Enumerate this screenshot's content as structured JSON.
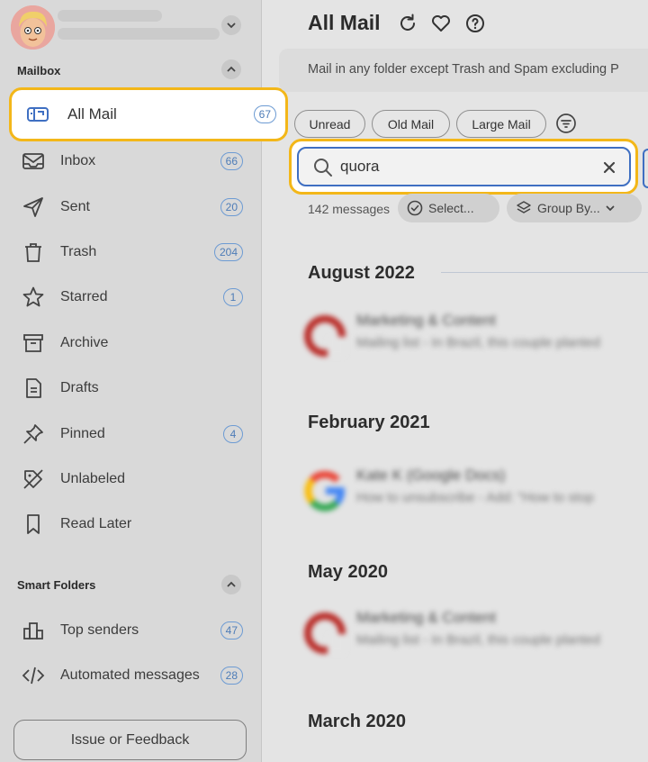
{
  "sidebar": {
    "mailbox_title": "Mailbox",
    "items": [
      {
        "label": "All Mail",
        "count": "67",
        "icon": "mailbox-icon",
        "active": true
      },
      {
        "label": "Inbox",
        "count": "66",
        "icon": "inbox-icon"
      },
      {
        "label": "Sent",
        "count": "20",
        "icon": "paper-plane-icon"
      },
      {
        "label": "Trash",
        "count": "204",
        "icon": "trash-icon"
      },
      {
        "label": "Starred",
        "count": "1",
        "icon": "star-icon"
      },
      {
        "label": "Archive",
        "count": "",
        "icon": "archive-box-icon"
      },
      {
        "label": "Drafts",
        "count": "",
        "icon": "document-icon"
      },
      {
        "label": "Pinned",
        "count": "4",
        "icon": "pin-icon"
      },
      {
        "label": "Unlabeled",
        "count": "",
        "icon": "label-off-icon"
      },
      {
        "label": "Read Later",
        "count": "",
        "icon": "bookmark-icon"
      }
    ],
    "smart_title": "Smart Folders",
    "smart_items": [
      {
        "label": "Top senders",
        "count": "47",
        "icon": "bar-chart-icon"
      },
      {
        "label": "Automated messages",
        "count": "28",
        "icon": "code-icon"
      }
    ],
    "feedback_label": "Issue or Feedback"
  },
  "main": {
    "title": "All Mail",
    "description": "Mail in any folder except Trash and Spam excluding P",
    "chips": [
      "Unread",
      "Old Mail",
      "Large Mail"
    ],
    "search": {
      "value": "quora",
      "placeholder": ""
    },
    "message_count": "142 messages",
    "select_label": "Select...",
    "group_by_label": "Group By...",
    "groups": [
      {
        "heading": "August 2022",
        "sender": "Marketing & Content",
        "snippet": "Mailing list - In Brazil, this couple planted",
        "logo": "quora"
      },
      {
        "heading": "February 2021",
        "sender": "Kate K (Google Docs)",
        "snippet": "How to unsubscribe - Add: \"How to stop",
        "logo": "google"
      },
      {
        "heading": "May 2020",
        "sender": "Marketing & Content",
        "snippet": "Mailing list - In Brazil, this couple planted",
        "logo": "quora"
      },
      {
        "heading": "March 2020"
      }
    ]
  },
  "colors": {
    "accent_yellow": "#f3b719",
    "badge_blue": "#4d7cb7",
    "search_border": "#3f6fc2",
    "quora_red": "#b92b27"
  }
}
